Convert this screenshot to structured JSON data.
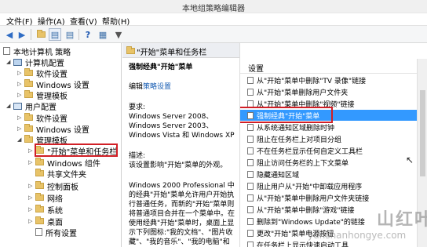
{
  "window": {
    "title": "本地组策略编辑器"
  },
  "menu": {
    "file": "文件(F)",
    "action": "操作(A)",
    "view": "查看(V)",
    "help": "帮助(H)"
  },
  "toolbar_icons": [
    "back-arrow-icon",
    "forward-arrow-icon",
    "up-folder-icon",
    "show-tree-icon",
    "export-icon",
    "help-icon",
    "view-icon",
    "filter-icon"
  ],
  "tree": {
    "root": "本地计算机 策略",
    "computer_config": "计算机配置",
    "software_settings": "软件设置",
    "windows_settings": "Windows 设置",
    "admin_templates": "管理模板",
    "user_config": "用户配置",
    "u_software_settings": "软件设置",
    "u_windows_settings": "Windows 设置",
    "u_admin_templates": "管理模板",
    "start_menu": "\"开始\"菜单和任务栏",
    "windows_components": "Windows 组件",
    "shared_folders": "共享文件夹",
    "control_panel": "控制面板",
    "network": "网络",
    "system": "系统",
    "desktop": "桌面",
    "all_settings": "所有设置"
  },
  "middle": {
    "header": "\"开始\"菜单和任务栏",
    "title": "强制经典\"开始\"菜单",
    "edit_prefix": "编辑",
    "edit_link": "策略设置",
    "req_label": "要求:",
    "req_lines": [
      "Windows Server 2008、",
      "Windows Server 2003、",
      "Windows Vista 和 Windows XP"
    ],
    "desc_label": "描述:",
    "desc_line": "该设置影响\"开始\"菜单的外观。",
    "body_lines": [
      "Windows 2000 Professional 中",
      "的经典\"开始\"菜单允许用户开始执",
      "行普通任务，而新的\"开始\"菜单则",
      "将普通项目合并在一个菜单中。在",
      "使用经典\"开始\"菜单时，桌面上显",
      "示下列图标:\"我的文档\"、\"图片收",
      "藏\"、\"我的音乐\"、\"我的电脑\"和"
    ]
  },
  "right": {
    "col_header": "设置",
    "rows": [
      "从\"开始\"菜单中删除\"TV 录像\"链接",
      "从\"开始\"菜单删除用户文件夹",
      "从\"开始\"菜单中删除\"视频\"链接",
      "强制经典\"开始\"菜单",
      "从系统通知区域删除时钟",
      "阻止在任务栏上对项目分组",
      "不在任务栏显示任何自定义工具栏",
      "阻止访问任务栏的上下文菜单",
      "隐藏通知区域",
      "阻止用户从\"开始\"中卸载应用程序",
      "从\"开始\"菜单中删除用户文件夹链接",
      "从\"开始\"菜单中删除\"游戏\"链接",
      "删除到\"Windows Update\"的链接",
      "更改\"开始\"菜单电源按钮",
      "在任务栏上显示快速启动工具"
    ],
    "selected_index": 3
  },
  "watermark": {
    "text": "yunshanhongye.com",
    "brand": "山红叶"
  }
}
